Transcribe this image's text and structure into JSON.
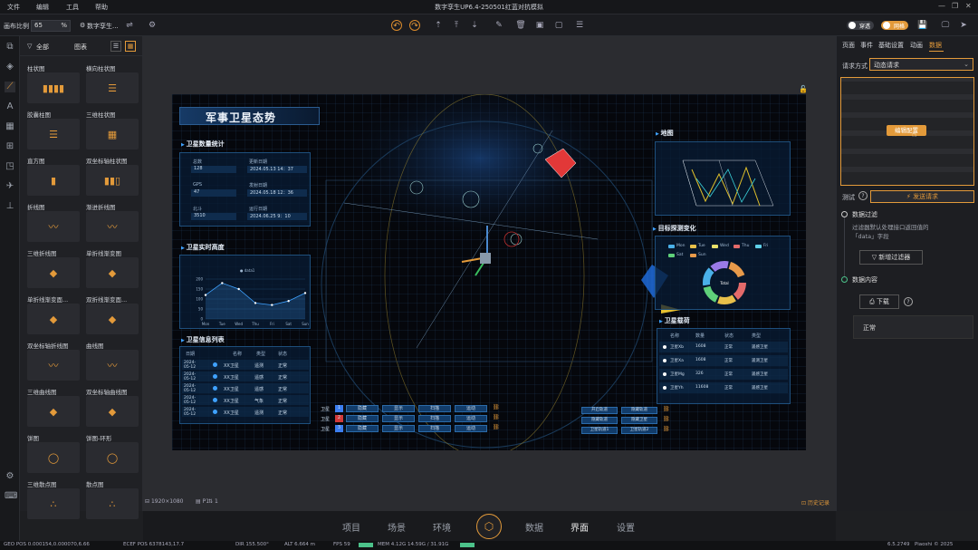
{
  "title_bar": {
    "menus": [
      "文件",
      "编辑",
      "工具",
      "帮助"
    ],
    "window_title": "数字孪生UP6.4-250501红蓝对抗模拟"
  },
  "toolbar": {
    "scale_label": "画布比例",
    "scale_value": "65",
    "scale_unit": "%",
    "twin_label": "数字孪生...",
    "toggle1": "穿透",
    "toggle2": "网格"
  },
  "lib": {
    "tab_all": "全部",
    "tab_chart": "图表",
    "cards": [
      "柱状图",
      "横向柱状图",
      "胶囊柱图",
      "三维柱状图",
      "直方图",
      "双坐标轴柱状图",
      "折线图",
      "渐进折线图",
      "三维折线图",
      "单折线渐变图",
      "单折线渐变面...",
      "双折线渐变面...",
      "双坐标轴折线图",
      "曲线图",
      "三维曲线图",
      "双坐标轴曲线图",
      "饼图",
      "饼图-环形",
      "三维散点图",
      "散点图"
    ]
  },
  "screen": {
    "main_title": "军事卫星态势",
    "sat_stats": {
      "title": "卫星数量统计",
      "items": [
        {
          "k": "总数",
          "v": "128",
          "k2": "更新日期",
          "v2": "2024.05.13  14：37"
        },
        {
          "k": "GPS",
          "v": "47",
          "k2": "发射日期",
          "v2": "2024.05.18  12：36"
        },
        {
          "k": "北斗",
          "v": "3510",
          "k2": "运行日期",
          "v2": "2024.06.25  9：10"
        }
      ]
    },
    "altitude": {
      "title": "卫星实时高度",
      "legend": "data1",
      "yticks": [
        "200",
        "150",
        "100",
        "50",
        "0"
      ],
      "xticks": [
        "Mon",
        "Tue",
        "Wed",
        "Thu",
        "Fri",
        "Sat",
        "Sun"
      ],
      "values": [
        120,
        180,
        150,
        80,
        70,
        90,
        130
      ]
    },
    "info_list": {
      "title": "卫星信息列表",
      "headers": [
        "日期",
        "名称",
        "类型",
        "状态"
      ],
      "rows": [
        [
          "2024-05-12",
          "XX卫星",
          "遥测",
          "正常"
        ],
        [
          "2024-05-12",
          "XX卫星",
          "遥感",
          "正常"
        ],
        [
          "2024-05-12",
          "XX卫星",
          "遥感",
          "正常"
        ],
        [
          "2024-05-12",
          "XX卫星",
          "气象",
          "正常"
        ],
        [
          "2024-05-12",
          "XX卫星",
          "遥测",
          "正常"
        ]
      ]
    },
    "map": {
      "title": "地图"
    },
    "detection": {
      "title": "目标探测变化",
      "legend": [
        "Mon",
        "Tue",
        "Wed",
        "Thu",
        "Fri",
        "Sat",
        "Sun"
      ],
      "center": "Total"
    },
    "payload": {
      "title": "卫星载荷",
      "headers": [
        "名称",
        "数量",
        "状态",
        "类型"
      ],
      "rows": [
        [
          "卫星Xb",
          "1608",
          "正常",
          "遥感卫星"
        ],
        [
          "卫星Xa",
          "1608",
          "正常",
          "遥测卫星"
        ],
        [
          "卫星Mg",
          "326",
          "正常",
          "遥感卫星"
        ],
        [
          "卫星Yh",
          "11608",
          "正常",
          "遥感卫星"
        ]
      ]
    },
    "controls": {
      "sats": [
        {
          "label": "卫星",
          "n": "1",
          "color": "#3c7ef0"
        },
        {
          "label": "卫星",
          "n": "2",
          "color": "#d23a3a"
        },
        {
          "label": "卫星",
          "n": "3",
          "color": "#3c7ef0"
        }
      ],
      "btns": [
        "隐藏",
        "显示",
        "扫描",
        "运动"
      ]
    },
    "right_controls": [
      "开启轨道",
      "隐藏轨道",
      "隐藏轨道",
      "隐藏卫星",
      "卫星轨道1",
      "卫星轨道2"
    ]
  },
  "canvas_footer": {
    "size": "1920×1080",
    "page": "P1",
    "count": "1",
    "history": "历史记录"
  },
  "right": {
    "tabs": [
      "页面",
      "事件",
      "基础设置",
      "动画",
      "数据"
    ],
    "req_label": "请求方式",
    "req_value": "动态请求",
    "edit_config": "编辑配置",
    "test_label": "测试",
    "send_btn": "发送请求",
    "filter_title": "数据过滤",
    "filter_desc1": "过滤器默认处理接口返回值的",
    "filter_desc2": "「data」字段",
    "add_filter": "新增过滤器",
    "content_title": "数据内容",
    "download": "下载",
    "status": "正常"
  },
  "bottom_nav": [
    "项目",
    "场景",
    "环境",
    "数据",
    "界面",
    "设置"
  ],
  "status_bar": {
    "geo": "GEO POS  0.000154,0.000070,6.66",
    "ecef": "ECEF POS  6378143,17.7",
    "dir": "DIR   155.500°",
    "alt": "ALT   6.664 m",
    "fps": "FPS   59",
    "mem": "MEM   4.12G   14.59G / 31.91G",
    "ver": "6.5.2749",
    "copy": "Piaoshi © 2025"
  },
  "colors": {
    "accent": "#e39a3a",
    "panel_border": "#1e4f7c",
    "highlight": "#3fa2ff"
  }
}
